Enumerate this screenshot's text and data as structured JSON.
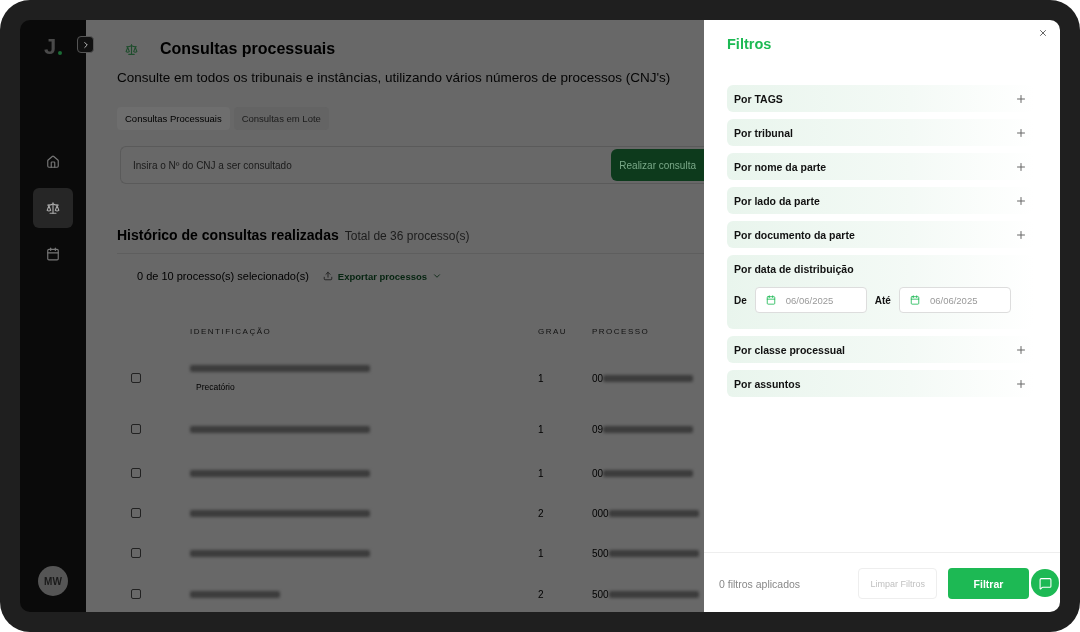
{
  "sidebar": {
    "logo": "J",
    "items": [
      {
        "kind": "home",
        "selected": false
      },
      {
        "kind": "scale",
        "selected": true
      },
      {
        "kind": "calendar",
        "selected": false
      }
    ],
    "avatar": "MW"
  },
  "page": {
    "title": "Consultas processuais",
    "subtitle": "Consulte em todos os tribunais e instâncias, utilizando vários números de processos (CNJ's)",
    "tabs": [
      {
        "label": "Consultas Processuais",
        "selected": true
      },
      {
        "label": "Consultas em Lote",
        "selected": false
      }
    ],
    "search": {
      "placeholder": "Insira o Nº do CNJ a ser consultado",
      "button": "Realizar consulta"
    },
    "history": {
      "title": "Histórico de consultas realizadas",
      "total": "Total de 36 processo(s)",
      "selection": "0 de 10 processo(s) selecionado(s)",
      "export": "Exportar processos"
    },
    "table": {
      "columns": [
        "IDENTIFICAÇÃO",
        "GRAU",
        "PROCESSO"
      ],
      "rows": [
        {
          "checked": false,
          "tag": "Precatório",
          "grau": "1",
          "processo": "00"
        },
        {
          "checked": false,
          "grau": "1",
          "processo": "09"
        },
        {
          "checked": false,
          "grau": "1",
          "processo": "00"
        },
        {
          "checked": false,
          "grau": "2",
          "processo": "000"
        },
        {
          "checked": false,
          "grau": "1",
          "processo": "500"
        },
        {
          "checked": false,
          "grau": "2",
          "processo": "500"
        }
      ]
    }
  },
  "filters": {
    "title": "Filtros",
    "items": [
      {
        "label": "Por TAGS",
        "expanded": false
      },
      {
        "label": "Por tribunal",
        "expanded": false
      },
      {
        "label": "Por nome da parte",
        "expanded": false
      },
      {
        "label": "Por lado da parte",
        "expanded": false
      },
      {
        "label": "Por documento da parte",
        "expanded": false
      },
      {
        "label": "Por data de distribuição",
        "expanded": true,
        "fields": [
          {
            "label": "De",
            "value": "06/06/2025"
          },
          {
            "label": "Até",
            "value": "06/06/2025"
          }
        ]
      },
      {
        "label": "Por classe processual",
        "expanded": false
      },
      {
        "label": "Por assuntos",
        "expanded": false
      }
    ],
    "applied": "0 filtros aplicados",
    "clear": "Limpar Filtros",
    "apply": "Filtrar"
  }
}
